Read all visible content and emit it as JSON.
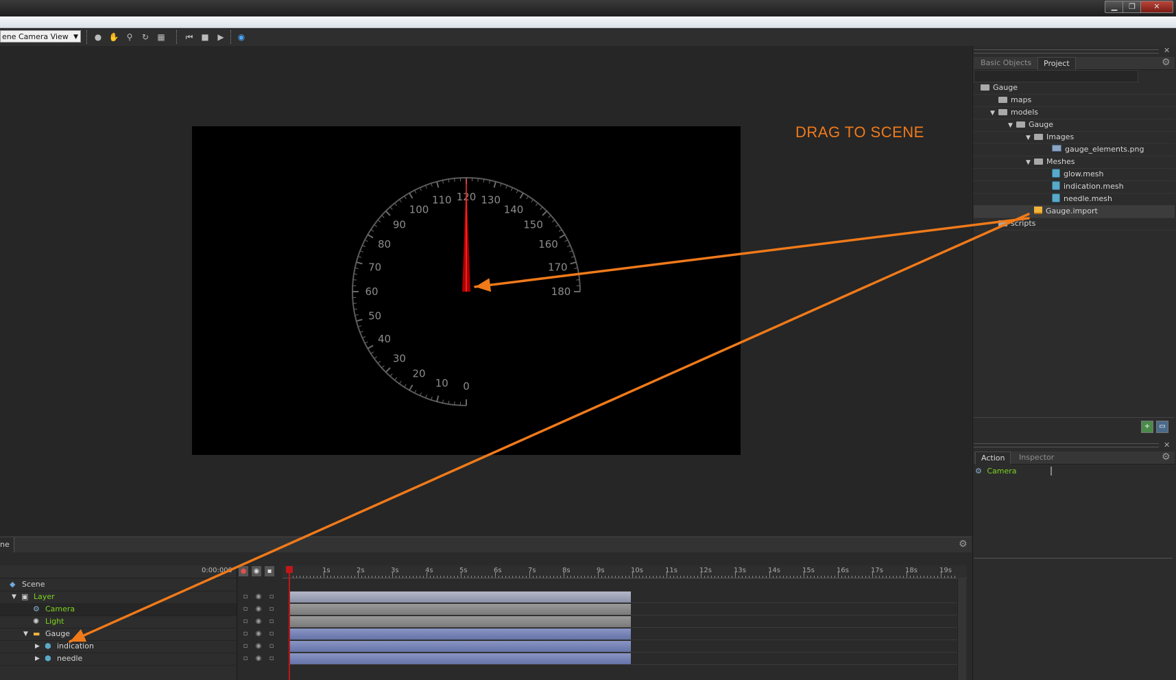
{
  "window": {
    "minimize_icon": "minimize-icon",
    "restore_icon": "restore-icon",
    "close_icon": "close-icon"
  },
  "toolbar": {
    "view_select_value": "ene Camera View",
    "tools": [
      "select-icon",
      "hand-icon",
      "zoom-icon",
      "rotate-icon",
      "grid-icon",
      "skip-start-icon",
      "stop-icon",
      "play-icon",
      "vr-icon"
    ]
  },
  "viewport": {
    "annotation": "DRAG TO SCENE",
    "gauge": {
      "labels": [
        "0",
        "10",
        "20",
        "30",
        "40",
        "50",
        "60",
        "70",
        "80",
        "90",
        "100",
        "110",
        "120",
        "130",
        "140",
        "150",
        "160",
        "170",
        "180"
      ],
      "needle_value": 120,
      "min": 0,
      "max": 180
    },
    "arrow_color": "#f07a1a"
  },
  "project_panel": {
    "tabs": [
      "Basic Objects",
      "Project"
    ],
    "active_tab": "Project",
    "tree": [
      {
        "label": "Gauge",
        "icon": "folder",
        "level": 0,
        "expander": ""
      },
      {
        "label": "maps",
        "icon": "folder",
        "level": 1,
        "expander": ""
      },
      {
        "label": "models",
        "icon": "folder",
        "level": 1,
        "expander": "▼"
      },
      {
        "label": "Gauge",
        "icon": "folder",
        "level": 2,
        "expander": "▼"
      },
      {
        "label": "Images",
        "icon": "folder",
        "level": 3,
        "expander": "▼"
      },
      {
        "label": "gauge_elements.png",
        "icon": "png",
        "level": 4,
        "expander": ""
      },
      {
        "label": "Meshes",
        "icon": "folder",
        "level": 3,
        "expander": "▼"
      },
      {
        "label": "glow.mesh",
        "icon": "mesh",
        "level": 4,
        "expander": ""
      },
      {
        "label": "indication.mesh",
        "icon": "mesh",
        "level": 4,
        "expander": ""
      },
      {
        "label": "needle.mesh",
        "icon": "mesh",
        "level": 4,
        "expander": ""
      },
      {
        "label": "Gauge.import",
        "icon": "import",
        "level": 3,
        "expander": ""
      },
      {
        "label": "scripts",
        "icon": "folder",
        "level": 1,
        "expander": ""
      }
    ]
  },
  "action_panel": {
    "tabs": [
      "Action",
      "Inspector"
    ],
    "active_tab": "Action",
    "item": "Camera"
  },
  "timeline": {
    "tab_label": "ne",
    "time_display": "0:00:000",
    "ruler_labels": [
      "1s",
      "2s",
      "3s",
      "4s",
      "5s",
      "6s",
      "7s",
      "8s",
      "9s",
      "10s",
      "11s",
      "12s",
      "13s",
      "14s",
      "15s",
      "16s",
      "17s",
      "18s",
      "19s"
    ],
    "rows": [
      {
        "label": "Scene",
        "color": "#d0d0d0",
        "indent": 0,
        "expander": "",
        "icon": "scene"
      },
      {
        "label": "Layer",
        "color": "#7ed321",
        "indent": 1,
        "expander": "▼",
        "icon": "layer"
      },
      {
        "label": "Camera",
        "color": "#7ed321",
        "indent": 2,
        "expander": "",
        "icon": "camera"
      },
      {
        "label": "Light",
        "color": "#7ed321",
        "indent": 2,
        "expander": "",
        "icon": "light"
      },
      {
        "label": "Gauge",
        "color": "#d6d6d6",
        "indent": 2,
        "expander": "▼",
        "icon": "import"
      },
      {
        "label": "indication",
        "color": "#d6d6d6",
        "indent": 3,
        "expander": "▶",
        "icon": "mesh"
      },
      {
        "label": "needle",
        "color": "#d6d6d6",
        "indent": 3,
        "expander": "▶",
        "icon": "mesh"
      }
    ],
    "clip_end_seconds": 10
  }
}
